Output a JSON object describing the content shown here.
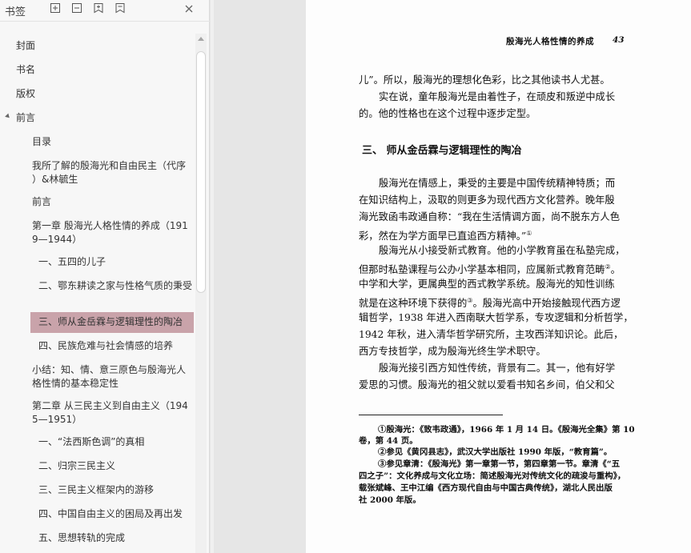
{
  "sidebar": {
    "title": "书签",
    "toolbar": {
      "expand_icon": "expand-all-icon",
      "collapse_icon": "collapse-all-icon",
      "add_icon": "add-bookmark-icon",
      "bookmark_icon": "bookmark-icon",
      "close_icon": "close-icon"
    },
    "items": [
      {
        "label": "封面"
      },
      {
        "label": "书名"
      },
      {
        "label": "版权"
      },
      {
        "label": "前言"
      },
      {
        "label": "目录"
      },
      {
        "label_1": "我所了解的殷海光和自由民主（代序",
        "label_2": "）&林毓生"
      },
      {
        "label": "前言"
      },
      {
        "label_1": "第一章  殷海光人格性情的养成（191",
        "label_2": "9—1944）"
      },
      {
        "label": "一、五四的儿子"
      },
      {
        "label": "二、鄂东耕读之家与性格气质的秉受"
      },
      {
        "label": "三、师从金岳霖与逻辑理性的陶冶"
      },
      {
        "label": "四、民族危难与社会情感的培养"
      },
      {
        "label_1": " 小结：知、情、意三原色与殷海光人",
        "label_2": "格性情的基本稳定性"
      },
      {
        "label_1": "第二章  从三民主义到自由主义（194",
        "label_2": "5—1951）"
      },
      {
        "label": "一、“法西斯色调”的真相"
      },
      {
        "label": "二、归宗三民主义"
      },
      {
        "label": "三、三民主义框架内的游移"
      },
      {
        "label": "四、中国自由主义的困局及再出发"
      },
      {
        "label": "五、思想转轨的完成"
      }
    ]
  },
  "page": {
    "running_head": "殷海光人格性情的养成",
    "page_number": "43",
    "lines": [
      "儿”。所以，殷海光的理想化色彩，比之其他读书人尤甚。",
      "实在说，童年殷海光是由着性子，在顽皮和叛逆中成长",
      "的。他的性格也在这个过程中逐步定型。",
      "三、 师从金岳霖与逻辑理性的陶冶",
      "殷海光在情感上，秉受的主要是中国传统精神特质；而",
      "在知识结构上，汲取的则更多为现代西方文化营养。晚年殷",
      "海光致函韦政通自称：“我在生活情调方面，尚不脱东方人色",
      "彩，然在为学方面早已直追西方精神。”",
      "①",
      "殷海光从小接受新式教育。他的小学教育虽在私塾完成，",
      "但那时私塾课程与公办小学基本相同，应属新式教育范畴",
      "②",
      "。",
      "中学和大学，更属典型的西式教学系统。殷海光的知性训练",
      "就是在这种环境下获得的",
      "③",
      "。殷海光高中开始接触现代西方逻",
      "辑哲学，1938 年进入西南联大哲学系，专攻逻辑和分析哲学，",
      "1942 年秋，进入清华哲学研究所，主攻西洋知识论。此后，",
      "西方专技哲学，成为殷海光终生学术职守。",
      "殷海光接引西方知性传统，背景有二。其一，他有好学",
      "爱思的习惯。殷海光的祖父就以爱看书知名乡间，伯父和父"
    ],
    "footnotes": [
      "①殷海光：《致韦政通》，1966 年 1 月 14 日。《殷海光全集》第 10",
      "卷，第 44 页。",
      "②参见《黄冈县志》，武汉大学出版社 1990 年版，“教育篇”。",
      "③参见章清：《殷海光》第一章第一节，第四章第一节。章清《“五",
      "四之子”：文化养成与文化立场：简述殷海光对传统文化的疏浚与重构》，",
      "载张斌峰、王中江编《西方现代自由与中国古典传统》，湖北人民出版",
      "社 2000 年版。"
    ]
  }
}
